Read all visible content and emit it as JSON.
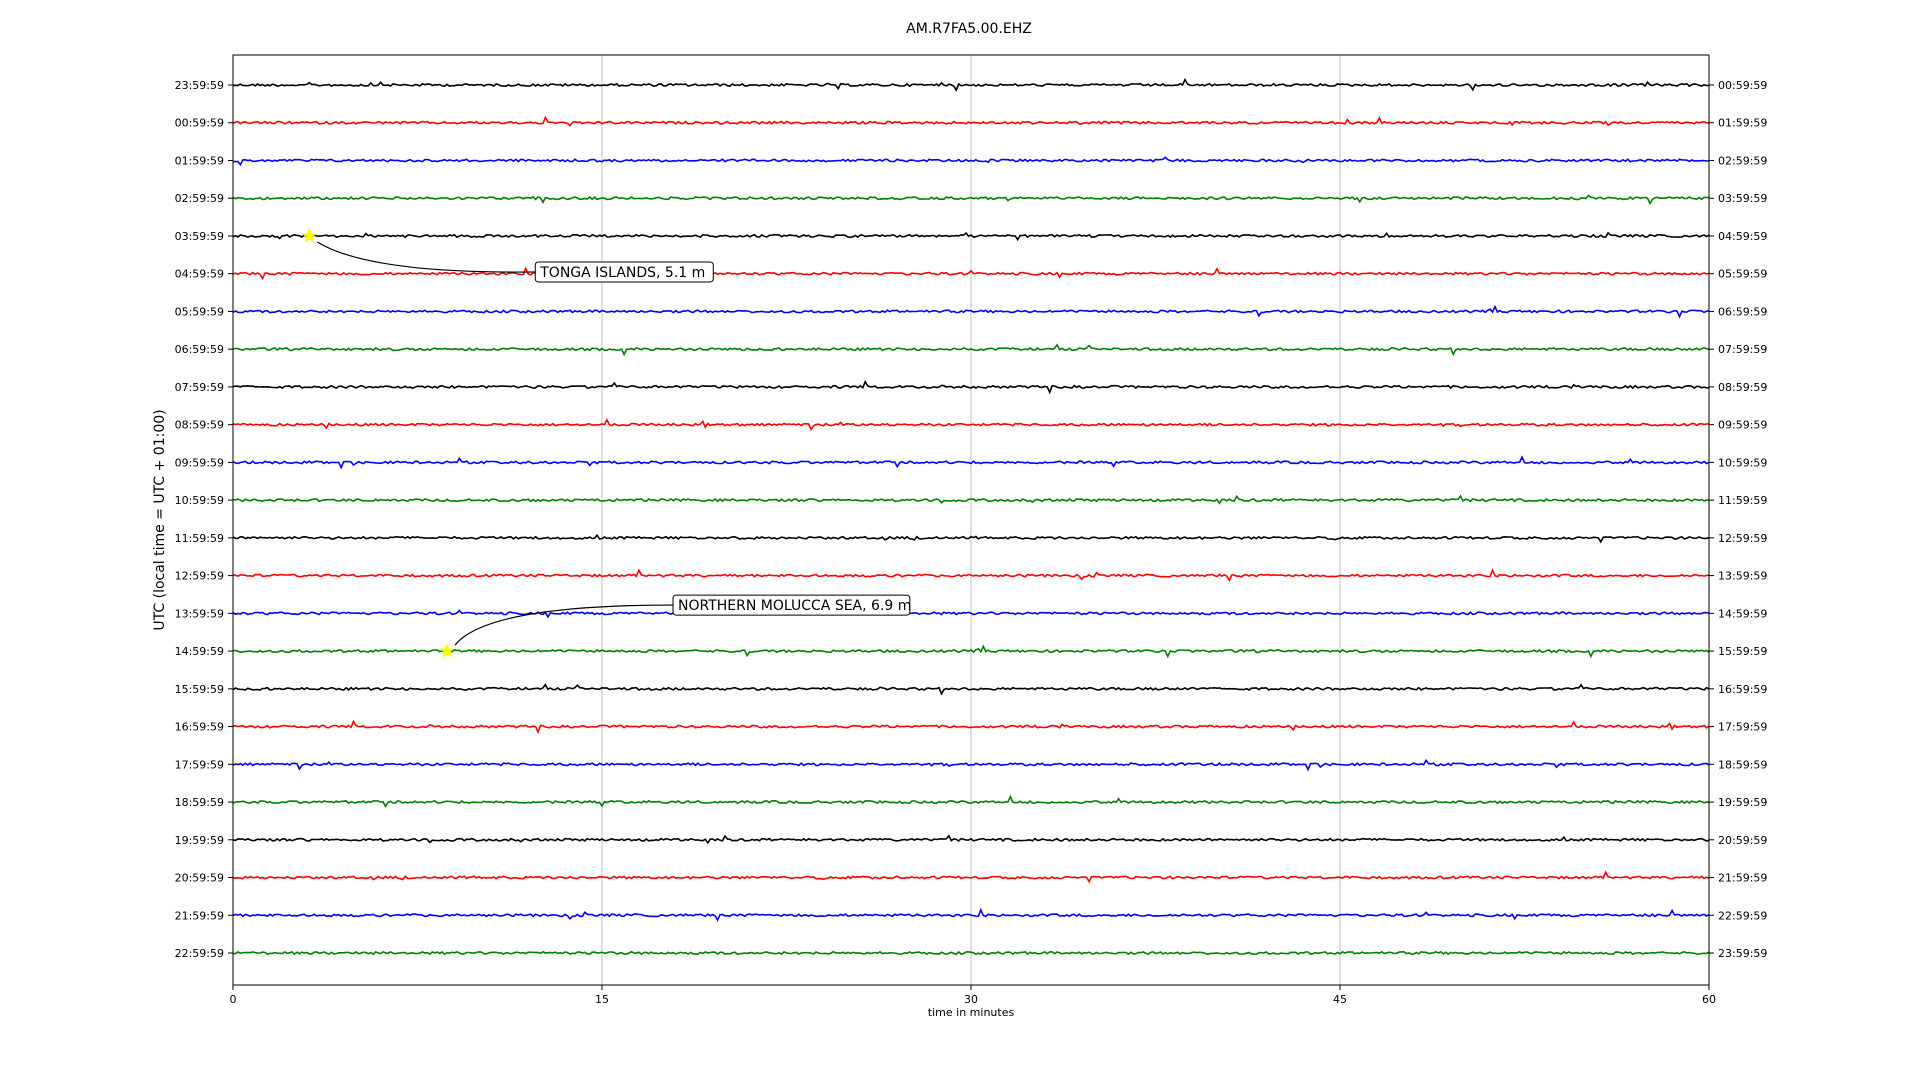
{
  "chart_data": {
    "type": "line",
    "title": "AM.R7FA5.00.EHZ",
    "xlabel": "time in minutes",
    "ylabel": "UTC (local time = UTC + 01:00)",
    "xlim": [
      0,
      60
    ],
    "xticks": [
      0,
      15,
      30,
      45,
      60
    ],
    "xtick_labels": [
      "0",
      "15",
      "30",
      "45",
      "60"
    ],
    "grid": "vertical",
    "trace_colors": [
      "#000000",
      "#ff0000",
      "#0000ff",
      "#008000"
    ],
    "left_labels": [
      "23:59:59",
      "00:59:59",
      "01:59:59",
      "02:59:59",
      "03:59:59",
      "04:59:59",
      "05:59:59",
      "06:59:59",
      "07:59:59",
      "08:59:59",
      "09:59:59",
      "10:59:59",
      "11:59:59",
      "12:59:59",
      "13:59:59",
      "14:59:59",
      "15:59:59",
      "16:59:59",
      "17:59:59",
      "18:59:59",
      "19:59:59",
      "20:59:59",
      "21:59:59",
      "22:59:59"
    ],
    "right_labels": [
      "00:59:59",
      "01:59:59",
      "02:59:59",
      "03:59:59",
      "04:59:59",
      "05:59:59",
      "06:59:59",
      "07:59:59",
      "08:59:59",
      "09:59:59",
      "10:59:59",
      "11:59:59",
      "12:59:59",
      "13:59:59",
      "14:59:59",
      "15:59:59",
      "16:59:59",
      "17:59:59",
      "18:59:59",
      "19:59:59",
      "20:59:59",
      "21:59:59",
      "22:59:59",
      "23:59:59"
    ],
    "events": [
      {
        "label": "TONGA ISLANDS, 5.1 m",
        "trace_index": 4,
        "minute": 3.1,
        "marker_color": "#ffff00"
      },
      {
        "label": "NORTHERN MOLUCCA SEA, 6.9 m",
        "trace_index": 15,
        "minute": 8.7,
        "marker_color": "#ffff00"
      }
    ]
  }
}
